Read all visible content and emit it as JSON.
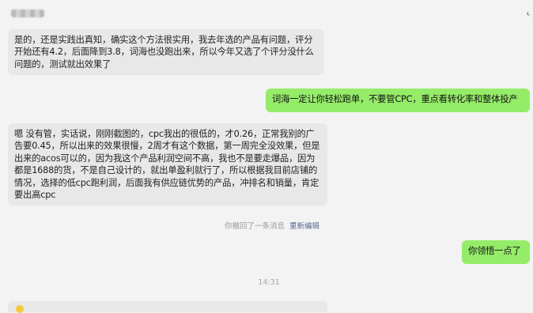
{
  "header": {
    "more_icon": "fold-icon"
  },
  "messages": [
    {
      "side": "incoming",
      "text": "是的，还是实践出真知，确实这个方法很实用，我去年选的产品有问题，评分开始还有4.2，后面降到3.8，词海也没跑出来，所以今年又选了个评分没什么问题的，测试就出效果了"
    },
    {
      "side": "outgoing",
      "text": "词海一定让你轻松跑单，不要管CPC，重点看转化率和整体投产"
    },
    {
      "side": "incoming",
      "text": "嗯 没有管，实话说，刚刚截图的，cpc我出的很低的，才0.26，正常我别的广告要0.45，所以出来的效果很慢，2周才有这个数据，第一周完全没效果，但是出来的acos可以的，因为我这个产品利润空间不高，我也不是要走爆品，因为都是1688的货，不是自己设计的，就出单盈利就行了，所以根据我目前店铺的情况，选择的低cpc跑利润，后面我有供应链优势的产品，冲排名和销量，肯定要出高cpc"
    },
    {
      "side": "outgoing",
      "text": "你领悟一点了"
    }
  ],
  "system": {
    "recall_text": "你撤回了一条消息",
    "reedit_label": "重新编辑",
    "timestamp": "14:31"
  }
}
